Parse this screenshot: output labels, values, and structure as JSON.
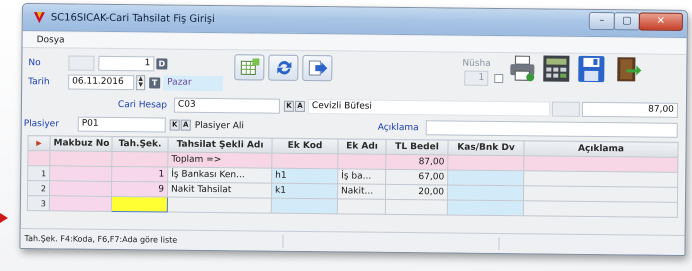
{
  "window": {
    "title": "SC16SICAK-Cari Tahsilat Fiş Girişi",
    "controls": {
      "minimize": "–",
      "maximize": "▢",
      "close": "✕"
    }
  },
  "menu": {
    "items": [
      "Dosya"
    ]
  },
  "header": {
    "no_label": "No",
    "no_value": "1",
    "no_button": "D",
    "tarih_label": "Tarih",
    "tarih_value": "06.11.2016",
    "spin_up": "▲",
    "spin_down": "▼",
    "t_button": "T",
    "day_name": "Pazar",
    "nusha_label": "Nüsha",
    "nusha_value": "1"
  },
  "cari": {
    "label": "Cari Hesap",
    "code": "C03",
    "k_button": "K",
    "a_button": "A",
    "name": "Cevizli Büfesi",
    "balance": "87,00"
  },
  "plasiyer": {
    "label": "Plasiyer",
    "code": "P01",
    "k_button": "K",
    "a_button": "A",
    "name": "Plasiyer Ali",
    "aciklama_label": "Açıklama",
    "aciklama_value": ""
  },
  "toolbar": {
    "buttons": [
      "table-calc-icon",
      "refresh-icon",
      "arrow-right-icon"
    ],
    "right_icons": [
      "printer-icon",
      "calculator-icon",
      "save-icon",
      "exit-icon"
    ]
  },
  "grid": {
    "columns": [
      "Makbuz No",
      "Tah.Şek.",
      "Tahsilat Şekli Adı",
      "Ek Kod",
      "Ek Adı",
      "TL Bedel",
      "Kas/Bnk Dv",
      "Açıklama"
    ],
    "total_row": {
      "label": "Toplam =>",
      "tl_bedel": "87,00"
    },
    "rows": [
      {
        "num": "1",
        "makbuz_no": "",
        "tah_sek": "1",
        "tahsilat_sekli_adi": "İş Bankası Ken...",
        "ek_kod": "h1",
        "ek_adi": "İş ba...",
        "tl_bedel": "67,00",
        "kas_bnk_dv": "",
        "aciklama": ""
      },
      {
        "num": "2",
        "makbuz_no": "",
        "tah_sek": "9",
        "tahsilat_sekli_adi": "Nakit Tahsilat",
        "ek_kod": "k1",
        "ek_adi": "Nakit...",
        "tl_bedel": "20,00",
        "kas_bnk_dv": "",
        "aciklama": ""
      },
      {
        "num": "3",
        "makbuz_no": "",
        "tah_sek": "",
        "tahsilat_sekli_adi": "",
        "ek_kod": "",
        "ek_adi": "",
        "tl_bedel": "",
        "kas_bnk_dv": "",
        "aciklama": ""
      }
    ]
  },
  "status": {
    "text": "Tah.Şek. F4:Koda, F6,F7:Ada göre liste"
  },
  "colors": {
    "label_blue": "#1a3cb4",
    "pink": "#f7d7eb",
    "blue": "#d3ebf8",
    "yellow": "#ffff33",
    "title_bar": "#a9c5e6"
  }
}
